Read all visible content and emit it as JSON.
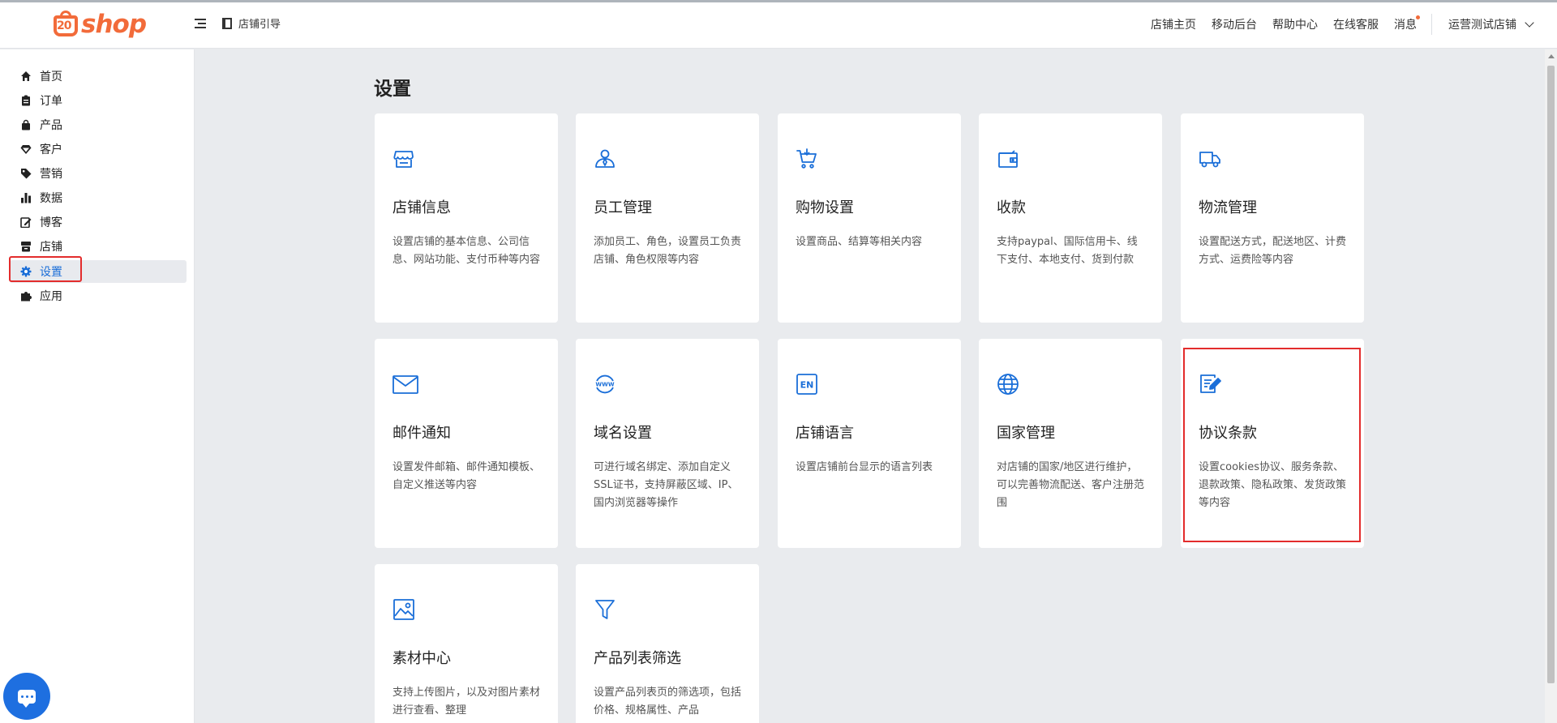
{
  "brand": {
    "logo_number": "20",
    "logo_text": "shop"
  },
  "header": {
    "guide_label": "店铺引导",
    "nav": [
      "店铺主页",
      "移动后台",
      "帮助中心",
      "在线客服"
    ],
    "messages_label": "消息",
    "store_name": "运营测试店铺"
  },
  "sidebar": {
    "items": [
      {
        "label": "首页",
        "icon": "home-icon"
      },
      {
        "label": "订单",
        "icon": "clipboard-icon"
      },
      {
        "label": "产品",
        "icon": "bag-icon"
      },
      {
        "label": "客户",
        "icon": "diamond-icon"
      },
      {
        "label": "营销",
        "icon": "tag-icon"
      },
      {
        "label": "数据",
        "icon": "bar-chart-icon"
      },
      {
        "label": "博客",
        "icon": "edit-icon"
      },
      {
        "label": "店铺",
        "icon": "store-icon"
      },
      {
        "label": "设置",
        "icon": "gear-icon",
        "active": true
      },
      {
        "label": "应用",
        "icon": "puzzle-icon"
      }
    ]
  },
  "page": {
    "title": "设置",
    "cards": [
      {
        "title": "店铺信息",
        "desc": "设置店铺的基本信息、公司信息、网站功能、支付币种等内容",
        "icon": "storefront-icon"
      },
      {
        "title": "员工管理",
        "desc": "添加员工、角色，设置员工负责店铺、角色权限等内容",
        "icon": "staff-icon"
      },
      {
        "title": "购物设置",
        "desc": "设置商品、结算等相关内容",
        "icon": "cart-icon"
      },
      {
        "title": "收款",
        "desc": "支持paypal、国际信用卡、线下支付、本地支付、货到付款",
        "icon": "wallet-icon"
      },
      {
        "title": "物流管理",
        "desc": "设置配送方式，配送地区、计费方式、运费险等内容",
        "icon": "truck-icon"
      },
      {
        "title": "邮件通知",
        "desc": "设置发件邮箱、邮件通知模板、自定义推送等内容",
        "icon": "mail-icon"
      },
      {
        "title": "域名设置",
        "desc": "可进行域名绑定、添加自定义SSL证书，支持屏蔽区域、IP、国内浏览器等操作",
        "icon": "www-icon"
      },
      {
        "title": "店铺语言",
        "desc": "设置店铺前台显示的语言列表",
        "icon": "language-icon"
      },
      {
        "title": "国家管理",
        "desc": "对店铺的国家/地区进行维护，可以完善物流配送、客户注册范围",
        "icon": "globe-icon"
      },
      {
        "title": "协议条款",
        "desc": "设置cookies协议、服务条款、退款政策、隐私政策、发货政策等内容",
        "icon": "document-edit-icon"
      },
      {
        "title": "素材中心",
        "desc": "支持上传图片，以及对图片素材进行查看、整理",
        "icon": "image-icon"
      },
      {
        "title": "产品列表筛选",
        "desc": "设置产品列表页的筛选项，包括价格、规格属性、产品",
        "icon": "filter-icon"
      }
    ]
  },
  "colors": {
    "accent": "#1a6ed8",
    "brand": "#f26b3a",
    "highlight": "#e32c2c"
  }
}
